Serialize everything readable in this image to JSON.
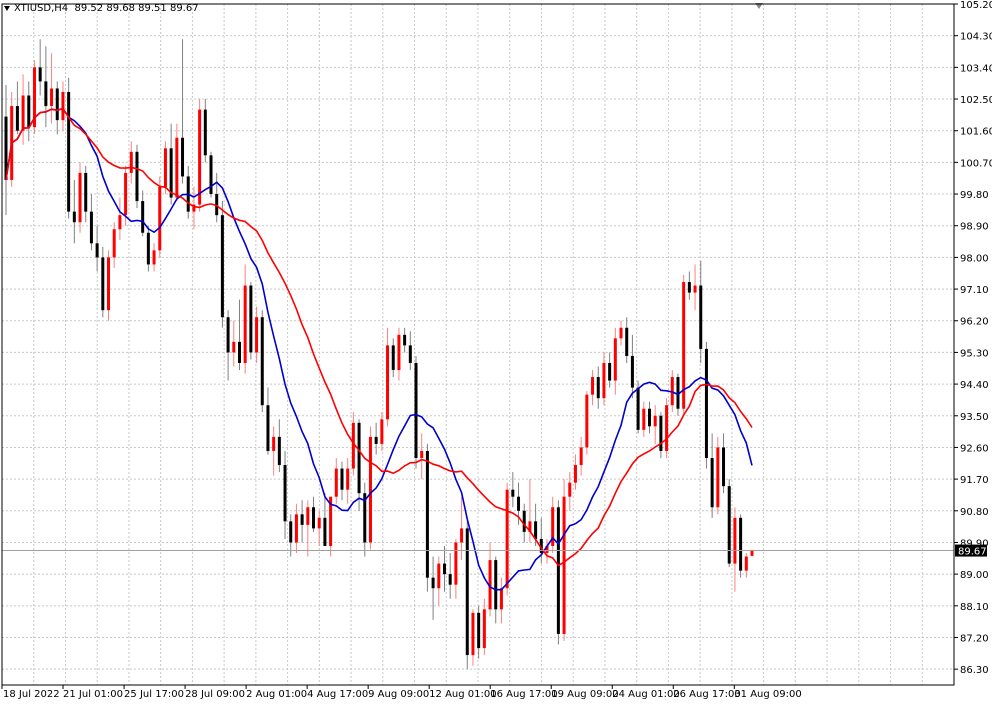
{
  "header": {
    "symbol": "XTIUSD,H4",
    "ohlc": "89.52 89.68 89.51 89.67"
  },
  "colors": {
    "bull": "#ff0000",
    "bear": "#000000",
    "ma_fast": "#0000cc",
    "ma_slow": "#ff0000",
    "grid": "#c8c8c8",
    "price_line": "#a0a0a0",
    "price_box": "#000000"
  },
  "chart_data": {
    "type": "candlestick",
    "grid": true,
    "ylim": [
      85.85,
      105.2
    ],
    "y_ticks": [
      "105.20",
      "104.30",
      "103.40",
      "102.50",
      "101.60",
      "100.70",
      "99.80",
      "98.90",
      "98.00",
      "97.10",
      "96.20",
      "95.30",
      "94.40",
      "93.50",
      "92.60",
      "91.70",
      "90.80",
      "89.90",
      "89.00",
      "88.10",
      "87.20",
      "86.30"
    ],
    "x_ticks": [
      "18 Jul 2022",
      "21 Jul 01:00",
      "25 Jul 17:00",
      "28 Jul 09:00",
      "2 Aug 01:00",
      "4 Aug 17:00",
      "9 Aug 09:00",
      "12 Aug 01:00",
      "16 Aug 17:00",
      "19 Aug 09:00",
      "24 Aug 01:00",
      "26 Aug 17:00",
      "31 Aug 09:00"
    ],
    "current_price": "89.67",
    "candles": [
      [
        102.0,
        102.9,
        99.2,
        100.2
      ],
      [
        100.2,
        102.7,
        100.0,
        102.3
      ],
      [
        102.3,
        103.0,
        101.5,
        101.6
      ],
      [
        101.6,
        103.2,
        101.2,
        102.6
      ],
      [
        102.6,
        103.0,
        101.3,
        101.7
      ],
      [
        101.7,
        103.6,
        101.5,
        103.4
      ],
      [
        103.4,
        104.2,
        102.6,
        103.0
      ],
      [
        103.0,
        104.0,
        101.7,
        102.3
      ],
      [
        102.3,
        103.8,
        101.8,
        102.8
      ],
      [
        102.8,
        103.0,
        101.5,
        101.9
      ],
      [
        101.9,
        103.0,
        101.6,
        102.7
      ],
      [
        102.7,
        103.1,
        99.1,
        99.3
      ],
      [
        99.3,
        100.2,
        98.4,
        99.0
      ],
      [
        99.0,
        100.7,
        98.7,
        100.4
      ],
      [
        100.4,
        100.6,
        99.0,
        99.3
      ],
      [
        99.3,
        99.8,
        98.2,
        98.4
      ],
      [
        98.4,
        98.9,
        97.6,
        98.0
      ],
      [
        98.0,
        98.3,
        96.3,
        96.5
      ],
      [
        96.5,
        98.2,
        96.2,
        98.0
      ],
      [
        98.0,
        99.0,
        97.7,
        98.8
      ],
      [
        98.8,
        99.7,
        98.5,
        99.2
      ],
      [
        99.2,
        100.6,
        98.9,
        100.4
      ],
      [
        100.4,
        101.3,
        100.1,
        101.0
      ],
      [
        101.0,
        101.2,
        99.4,
        99.6
      ],
      [
        99.6,
        99.9,
        98.6,
        98.7
      ],
      [
        98.7,
        98.9,
        97.6,
        97.8
      ],
      [
        97.8,
        98.4,
        97.6,
        98.2
      ],
      [
        98.2,
        100.3,
        98.0,
        100.0
      ],
      [
        100.0,
        101.3,
        99.8,
        101.1
      ],
      [
        101.1,
        101.8,
        99.5,
        99.7
      ],
      [
        99.7,
        101.8,
        99.6,
        101.4
      ],
      [
        101.4,
        104.2,
        100.1,
        100.3
      ],
      [
        100.3,
        100.6,
        99.1,
        99.3
      ],
      [
        99.3,
        100.0,
        98.8,
        99.5
      ],
      [
        99.5,
        102.5,
        99.3,
        102.2
      ],
      [
        102.2,
        102.5,
        100.7,
        100.9
      ],
      [
        100.9,
        101.0,
        99.7,
        99.8
      ],
      [
        99.8,
        100.4,
        99.0,
        99.2
      ],
      [
        99.2,
        99.6,
        96.0,
        96.3
      ],
      [
        96.3,
        96.5,
        94.5,
        95.3
      ],
      [
        95.3,
        96.2,
        94.9,
        95.6
      ],
      [
        95.6,
        96.8,
        94.8,
        95.0
      ],
      [
        95.0,
        97.8,
        94.7,
        97.2
      ],
      [
        97.2,
        97.3,
        95.1,
        95.3
      ],
      [
        95.3,
        96.6,
        95.0,
        96.3
      ],
      [
        96.3,
        96.5,
        93.6,
        93.8
      ],
      [
        93.8,
        94.3,
        92.4,
        92.5
      ],
      [
        92.5,
        93.2,
        91.8,
        92.9
      ],
      [
        92.9,
        93.4,
        91.9,
        92.1
      ],
      [
        92.1,
        92.5,
        90.0,
        90.5
      ],
      [
        90.5,
        90.7,
        89.5,
        89.9
      ],
      [
        89.9,
        91.0,
        89.6,
        90.7
      ],
      [
        90.7,
        91.1,
        89.9,
        90.4
      ],
      [
        90.4,
        91.1,
        89.5,
        90.9
      ],
      [
        90.9,
        91.2,
        90.2,
        90.3
      ],
      [
        90.3,
        90.8,
        89.8,
        90.6
      ],
      [
        90.6,
        91.3,
        90.0,
        89.8
      ],
      [
        89.8,
        90.7,
        89.5,
        91.2
      ],
      [
        91.2,
        92.3,
        91.0,
        92.0
      ],
      [
        92.0,
        92.2,
        91.1,
        91.4
      ],
      [
        91.4,
        92.3,
        91.0,
        92.0
      ],
      [
        92.0,
        93.6,
        91.8,
        93.3
      ],
      [
        93.3,
        93.4,
        90.8,
        91.3
      ],
      [
        91.3,
        91.6,
        89.5,
        89.9
      ],
      [
        89.9,
        93.2,
        89.7,
        92.9
      ],
      [
        92.9,
        93.3,
        92.4,
        92.7
      ],
      [
        92.7,
        93.6,
        92.5,
        93.4
      ],
      [
        93.4,
        96.0,
        93.2,
        95.5
      ],
      [
        95.5,
        95.7,
        94.6,
        94.8
      ],
      [
        94.8,
        96.0,
        94.5,
        95.8
      ],
      [
        95.8,
        96.0,
        95.3,
        95.5
      ],
      [
        95.5,
        95.9,
        94.8,
        95.0
      ],
      [
        95.0,
        95.2,
        92.0,
        92.3
      ],
      [
        92.3,
        93.0,
        91.7,
        92.5
      ],
      [
        92.5,
        92.7,
        88.5,
        88.9
      ],
      [
        88.9,
        89.5,
        87.7,
        88.6
      ],
      [
        88.6,
        89.5,
        88.1,
        89.3
      ],
      [
        89.3,
        89.8,
        88.5,
        89.0
      ],
      [
        89.0,
        89.6,
        88.3,
        88.7
      ],
      [
        88.7,
        90.0,
        88.3,
        89.9
      ],
      [
        89.9,
        91.2,
        89.4,
        90.3
      ],
      [
        90.3,
        90.5,
        86.3,
        86.7
      ],
      [
        86.7,
        88.0,
        86.4,
        87.9
      ],
      [
        87.9,
        88.1,
        86.6,
        86.9
      ],
      [
        86.9,
        88.3,
        86.7,
        88.0
      ],
      [
        88.0,
        89.9,
        87.8,
        89.4
      ],
      [
        89.4,
        89.5,
        87.6,
        88.0
      ],
      [
        88.0,
        88.9,
        87.6,
        88.6
      ],
      [
        88.6,
        91.6,
        88.4,
        91.4
      ],
      [
        91.4,
        91.9,
        90.9,
        91.2
      ],
      [
        91.2,
        91.6,
        90.4,
        90.8
      ],
      [
        90.8,
        91.0,
        89.9,
        90.2
      ],
      [
        90.2,
        91.7,
        89.9,
        90.5
      ],
      [
        90.5,
        91.0,
        89.8,
        90.0
      ],
      [
        90.0,
        90.6,
        89.3,
        89.6
      ],
      [
        89.6,
        90.0,
        89.3,
        89.8
      ],
      [
        89.8,
        91.2,
        89.6,
        90.9
      ],
      [
        90.9,
        91.1,
        87.0,
        87.3
      ],
      [
        87.3,
        91.7,
        87.1,
        91.2
      ],
      [
        91.2,
        91.9,
        90.8,
        91.6
      ],
      [
        91.6,
        92.4,
        91.4,
        92.1
      ],
      [
        92.1,
        92.9,
        91.8,
        92.6
      ],
      [
        92.6,
        94.2,
        92.4,
        94.1
      ],
      [
        94.1,
        94.8,
        93.8,
        94.6
      ],
      [
        94.6,
        94.9,
        93.7,
        94.0
      ],
      [
        94.0,
        95.3,
        93.8,
        95.0
      ],
      [
        95.0,
        95.3,
        94.3,
        94.5
      ],
      [
        94.5,
        96.0,
        94.1,
        95.7
      ],
      [
        95.7,
        96.2,
        95.5,
        96.0
      ],
      [
        96.0,
        96.3,
        95.0,
        95.2
      ],
      [
        95.2,
        95.8,
        94.0,
        94.3
      ],
      [
        94.3,
        94.5,
        93.0,
        93.1
      ],
      [
        93.1,
        93.9,
        92.9,
        93.7
      ],
      [
        93.7,
        93.9,
        93.0,
        93.2
      ],
      [
        93.2,
        93.8,
        92.7,
        93.5
      ],
      [
        93.5,
        93.6,
        92.3,
        92.5
      ],
      [
        92.5,
        94.0,
        92.3,
        93.8
      ],
      [
        93.8,
        94.8,
        93.6,
        94.6
      ],
      [
        94.6,
        94.7,
        93.5,
        93.7
      ],
      [
        93.7,
        97.5,
        93.5,
        97.3
      ],
      [
        97.3,
        97.6,
        96.8,
        97.0
      ],
      [
        97.0,
        97.8,
        96.5,
        97.2
      ],
      [
        97.2,
        97.9,
        95.0,
        95.4
      ],
      [
        95.4,
        95.6,
        92.0,
        92.3
      ],
      [
        92.3,
        93.0,
        90.6,
        90.9
      ],
      [
        90.9,
        92.9,
        90.7,
        92.6
      ],
      [
        92.6,
        93.0,
        91.3,
        91.5
      ],
      [
        91.5,
        91.7,
        89.2,
        89.3
      ],
      [
        89.3,
        90.9,
        88.5,
        90.6
      ],
      [
        90.6,
        90.7,
        88.9,
        89.1
      ],
      [
        89.1,
        89.6,
        88.9,
        89.5
      ],
      [
        89.52,
        89.68,
        89.51,
        89.67
      ]
    ]
  }
}
